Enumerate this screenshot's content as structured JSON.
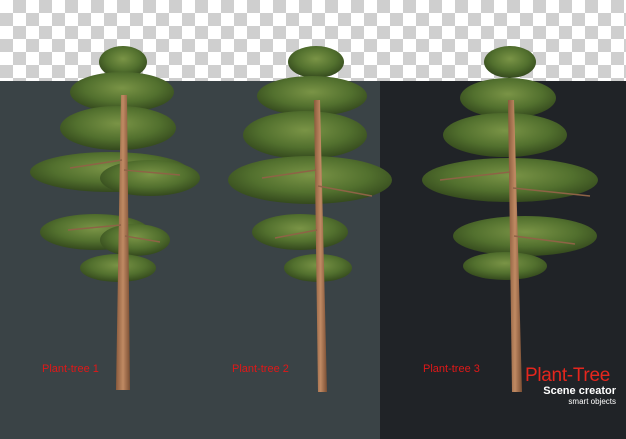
{
  "labels": {
    "tree1": "Plant-tree 1",
    "tree2": "Plant-tree 2",
    "tree3": "Plant-tree 3"
  },
  "brand": {
    "title": "Plant-Tree",
    "subtitle": "Scene creator",
    "tagline": "smart objects"
  },
  "colors": {
    "panel_light": "#3a4346",
    "panel_dark": "#202327",
    "foliage": "#4f6b2c",
    "trunk": "#b07a55",
    "label_red": "#e01818"
  }
}
